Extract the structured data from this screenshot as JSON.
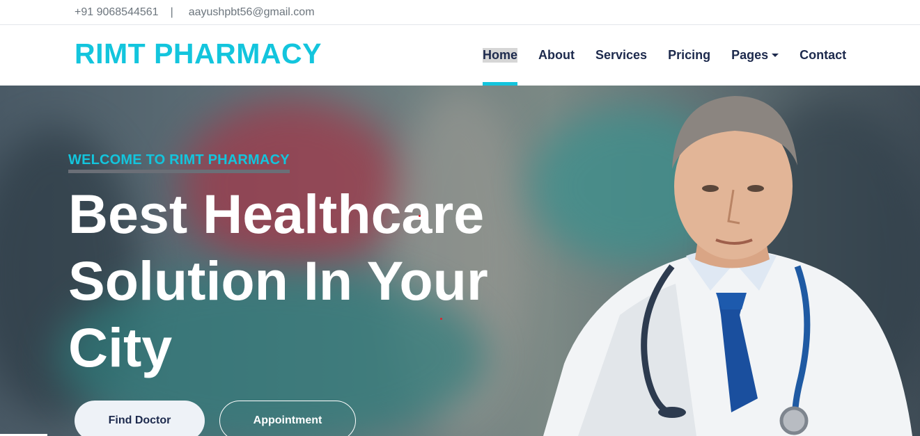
{
  "topbar": {
    "phone": "+91 9068544561",
    "separator": "|",
    "email": "aayushpbt56@gmail.com"
  },
  "navbar": {
    "brand": "RIMT PHARMACY",
    "items": [
      {
        "label": "Home",
        "active": true
      },
      {
        "label": "About"
      },
      {
        "label": "Services"
      },
      {
        "label": "Pricing"
      },
      {
        "label": "Pages",
        "dropdown": true
      },
      {
        "label": "Contact"
      }
    ]
  },
  "hero": {
    "welcome": "WELCOME TO RIMT PHARMACY",
    "headline": "Best Healthcare Solution In Your City",
    "buttons": {
      "find_doctor": "Find Doctor",
      "appointment": "Appointment"
    }
  },
  "colors": {
    "accent": "#13c5dd",
    "nav_text": "#1d2a4d",
    "active_bg": "#d6d6d6"
  },
  "icons": {
    "dropdown": "caret-down-icon"
  }
}
